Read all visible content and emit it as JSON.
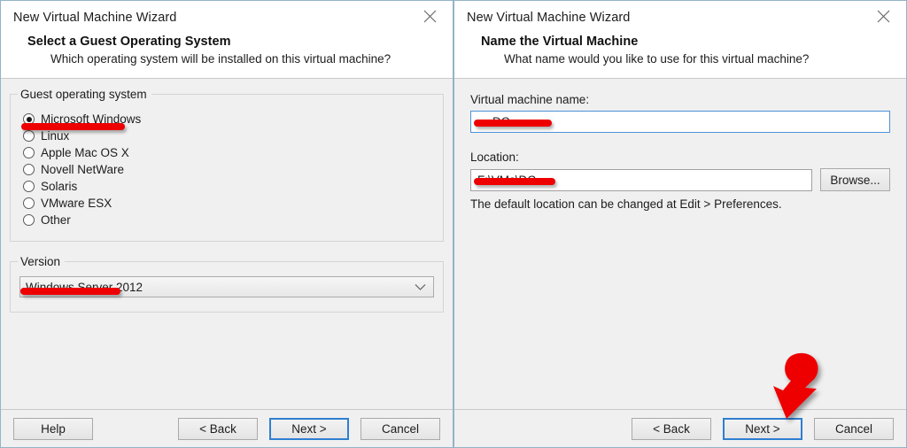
{
  "theme": {
    "accent_blue": "#2f7fd0",
    "annotation_red": "#ee0000",
    "dialog_border": "#92b4c6",
    "content_bg": "#f0f0f0"
  },
  "left_dialog": {
    "title": "New Virtual Machine Wizard",
    "close_icon": "close-icon",
    "header_title": "Select a Guest Operating System",
    "header_subtitle": "Which operating system will be installed on this virtual machine?",
    "guest_os_group": {
      "legend": "Guest operating system",
      "options": [
        {
          "label": "Microsoft Windows",
          "selected": true
        },
        {
          "label": "Linux",
          "selected": false
        },
        {
          "label": "Apple Mac OS X",
          "selected": false
        },
        {
          "label": "Novell NetWare",
          "selected": false
        },
        {
          "label": "Solaris",
          "selected": false
        },
        {
          "label": "VMware ESX",
          "selected": false
        },
        {
          "label": "Other",
          "selected": false
        }
      ]
    },
    "version_group": {
      "legend": "Version",
      "selected_value": "Windows Server 2012",
      "dropdown_icon": "chevron-down-icon"
    },
    "footer": {
      "help_label": "Help",
      "back_label": "< Back",
      "next_label": "Next >",
      "cancel_label": "Cancel",
      "default_button": "Next >"
    },
    "annotations": [
      {
        "type": "underline",
        "target": "Microsoft Windows"
      },
      {
        "type": "underline",
        "target": "Windows Server 2012"
      }
    ]
  },
  "right_dialog": {
    "title": "New Virtual Machine Wizard",
    "close_icon": "close-icon",
    "header_title": "Name the Virtual Machine",
    "header_subtitle": "What name would you like to use for this virtual machine?",
    "vm_name": {
      "label": "Virtual machine name:",
      "value": "DC",
      "focused": true
    },
    "location": {
      "label": "Location:",
      "value": "F:\\VMs\\DC",
      "browse_label": "Browse...",
      "hint": "The default location can be changed at Edit > Preferences."
    },
    "footer": {
      "back_label": "< Back",
      "next_label": "Next >",
      "cancel_label": "Cancel",
      "default_button": "Next >"
    },
    "annotations": [
      {
        "type": "underline",
        "target": "DC"
      },
      {
        "type": "underline",
        "target": "F:\\VMs\\DC"
      },
      {
        "type": "arrow",
        "target": "Next >",
        "direction": "down-left",
        "color": "#ee0000"
      }
    ]
  }
}
